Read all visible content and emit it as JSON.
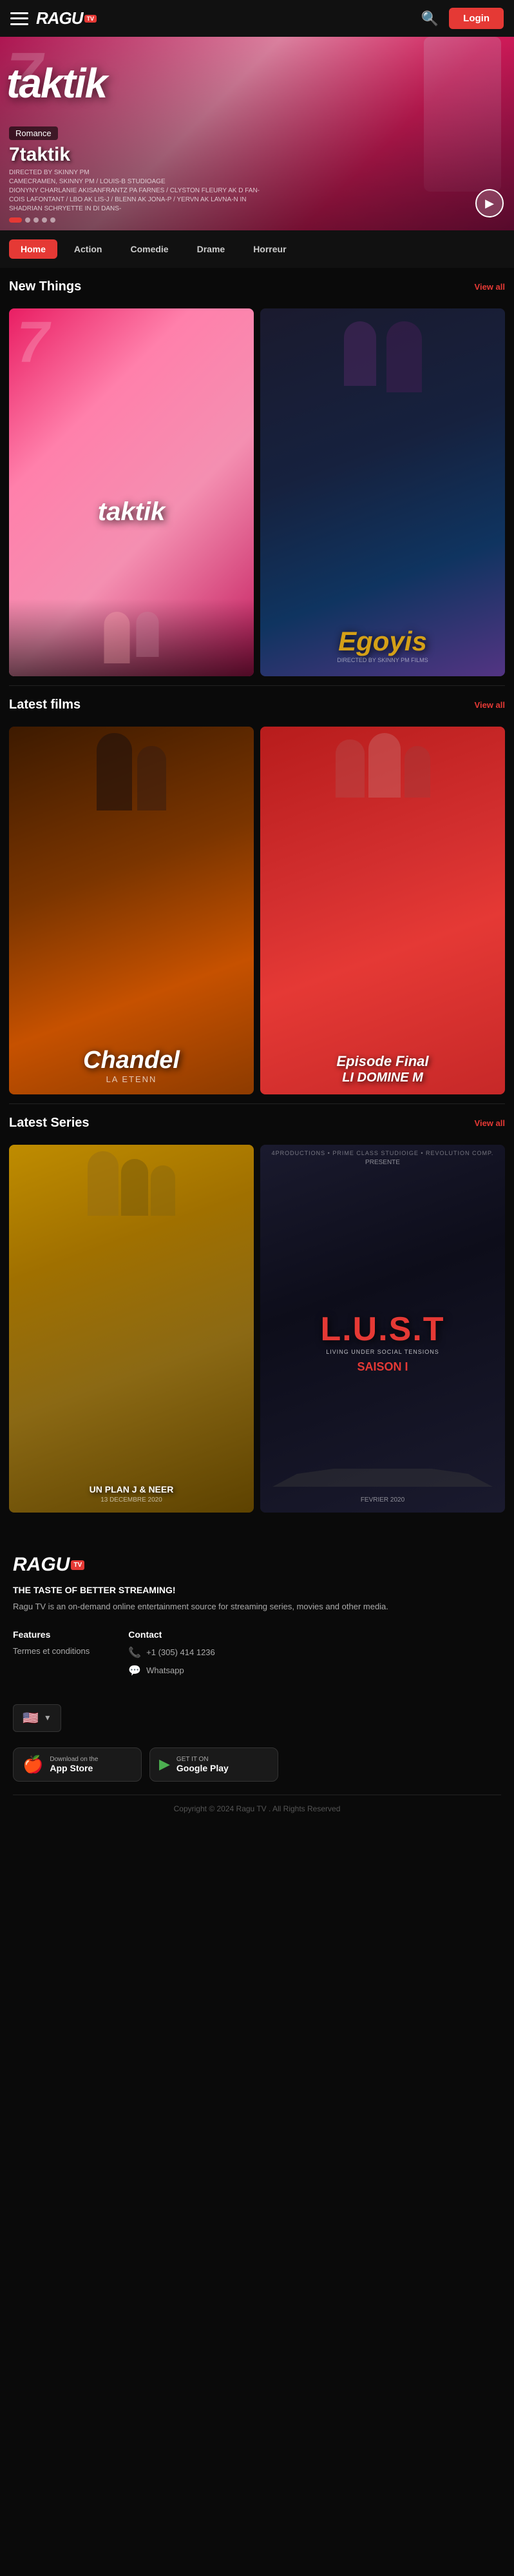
{
  "header": {
    "logo_text": "RAGU",
    "logo_badge": "TV",
    "login_label": "Login"
  },
  "hero": {
    "genre": "Romance",
    "title": "7taktik",
    "meta_line1": "DIRECTED BY SKINNY PM",
    "meta_line2": "CAMECRAMEN, SKINNY PM / LOUIS-B STUDIOAGE",
    "meta_line3": "DIONYNY CHARLANIE AKISANFRANTZ PA FARNES / CLYSTON FLEURY AK D FAN-",
    "meta_line4": "COIS LAFONTANT / LBO AK LIS-J / BLENN AK JONA-P / YERVN AK LAVNA-N IN",
    "meta_line5": "SHADRIAN SCHRYETTE IN DI DANS-",
    "play_label": "▶",
    "dots": [
      {
        "active": true
      },
      {
        "active": false
      },
      {
        "active": false
      },
      {
        "active": false
      },
      {
        "active": false
      }
    ]
  },
  "genre_tabs": [
    {
      "label": "Home",
      "active": true
    },
    {
      "label": "Action",
      "active": false
    },
    {
      "label": "Comedie",
      "active": false
    },
    {
      "label": "Drame",
      "active": false
    },
    {
      "label": "Horreur",
      "active": false
    }
  ],
  "new_things": {
    "section_title": "New Things",
    "view_all_label": "View all",
    "movies": [
      {
        "title": "7taktik",
        "style": "7taktik",
        "number": "7"
      },
      {
        "title": "Egoyis",
        "style": "egoyis"
      }
    ]
  },
  "latest_films": {
    "section_title": "Latest films",
    "view_all_label": "View all",
    "movies": [
      {
        "title": "Chandel",
        "subtitle": "LA ETENN",
        "style": "chandel"
      },
      {
        "title": "Episode Final",
        "subtitle": "LI DOMINE M",
        "style": "lidomine"
      }
    ]
  },
  "latest_series": {
    "section_title": "Latest Series",
    "view_all_label": "View all",
    "series": [
      {
        "title": "UN PLAN J & NEER",
        "subtitle": "13 DECEMBRE 2020",
        "style": "unplan"
      },
      {
        "title": "L.U.S.T",
        "subtitle": "LIVING UNDER SOCIAL TENSIONS",
        "season": "SAISON I",
        "date": "FEVRIER 2020",
        "style": "lust"
      }
    ]
  },
  "footer": {
    "logo_text": "RAGU",
    "logo_badge": "TV",
    "tagline": "THE TASTE OF BETTER STREAMING!",
    "description": "Ragu TV is an on-demand online entertainment source for streaming series, movies and other media.",
    "links_col1": {
      "heading": "Features",
      "items": [
        {
          "label": "Termes et conditions"
        }
      ]
    },
    "links_col2": {
      "heading": "Contact",
      "phone": "+1 (305) 414 1236",
      "whatsapp": "Whatsapp"
    },
    "copyright": "Copyright © 2024 Ragu TV . All Rights Reserved",
    "app_store": {
      "label_pre": "Download on the",
      "label": "App Store",
      "icon": "🍎"
    },
    "google_play": {
      "label_pre": "GET IT ON",
      "label": "Google Play",
      "icon": "▶"
    },
    "language": {
      "flag": "🇺🇸"
    }
  },
  "icons": {
    "hamburger": "≡",
    "search": "🔍",
    "phone": "📞",
    "whatsapp": "💬",
    "chevron_down": "▼"
  }
}
